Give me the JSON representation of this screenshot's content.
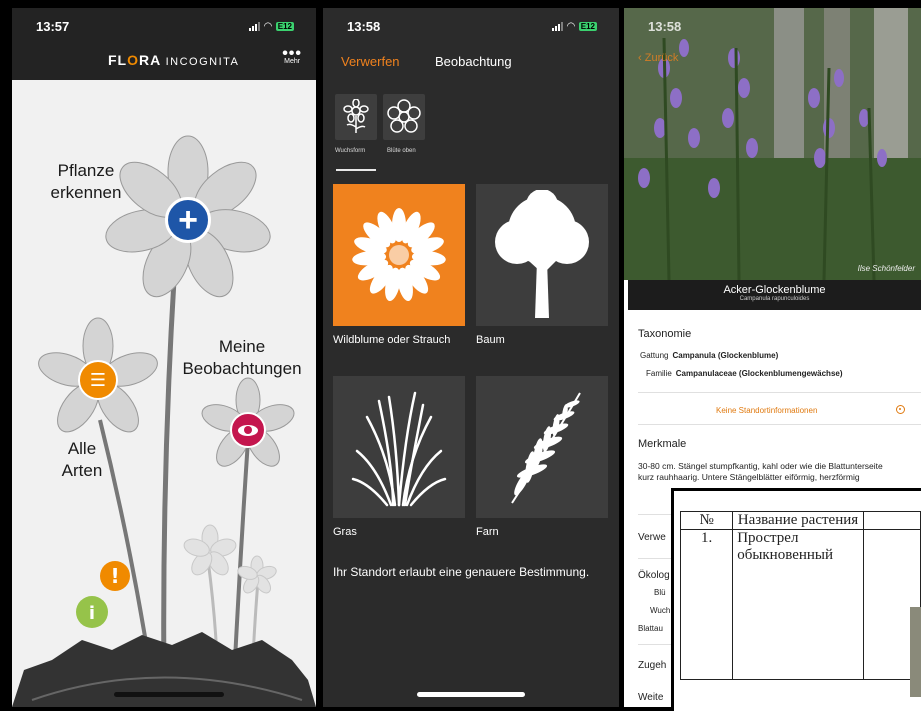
{
  "panel1": {
    "time": "13:57",
    "logo": {
      "part1": "FL",
      "part2": "O",
      "part3": "RA",
      "part4": "INCOGNITA"
    },
    "more_label": "Mehr",
    "identify_label_1": "Pflanze",
    "identify_label_2": "erkennen",
    "all_species_label_1": "Alle",
    "all_species_label_2": "Arten",
    "observations_label_1": "Meine",
    "observations_label_2": "Beobachtungen",
    "battery": "E12",
    "colors": {
      "identify": "#1e56a8",
      "all_species": "#f08a00",
      "observations": "#c4164e"
    }
  },
  "panel2": {
    "time": "13:58",
    "discard_label": "Verwerfen",
    "title": "Beobachtung",
    "tabs": [
      {
        "label": "Wuchsform",
        "icon": "flower-side-icon"
      },
      {
        "label": "Blüte oben",
        "icon": "flower-top-icon"
      }
    ],
    "categories": [
      {
        "label": "Wildblume oder Strauch",
        "icon": "daisy-icon",
        "selected": true
      },
      {
        "label": "Baum",
        "icon": "tree-icon",
        "selected": false
      },
      {
        "label": "Gras",
        "icon": "grass-icon",
        "selected": false
      },
      {
        "label": "Farn",
        "icon": "fern-icon",
        "selected": false
      }
    ],
    "hint": "Ihr Standort erlaubt eine genauere Bestimmung.",
    "accent_color": "#f0821e",
    "battery": "E12"
  },
  "panel3": {
    "time": "13:58",
    "back_label": "Zurück",
    "common_name": "Acker-Glockenblume",
    "latin_name": "Campanula rapunculoides",
    "credit": "Ilse Schönfelder",
    "taxonomy_title": "Taxonomie",
    "genus_key": "Gattung",
    "genus_value": "Campanula (Glockenblume)",
    "family_key": "Familie",
    "family_value": "Campanulaceae (Glockenblumengewächse)",
    "no_location": "Keine Standortinformationen",
    "features_title": "Merkmale",
    "description": "30-80 cm. Stängel stumpfkantig, kahl oder wie die Blattunterseite kurz rauhhaarig. Untere Stängelblätter eiförmig, herzförmig",
    "truncated_1": "Verwe",
    "truncated_2": "Ökolog",
    "truncated_3": "Blü",
    "truncated_4": "Wuch",
    "truncated_5": "Blattau",
    "truncated_6": "Zugeh",
    "truncated_7": "Weite"
  },
  "overlay_table": {
    "col_num": "№",
    "col_name": "Название растения",
    "row_num": "1.",
    "row_name": "Прострел обыкновенный"
  }
}
